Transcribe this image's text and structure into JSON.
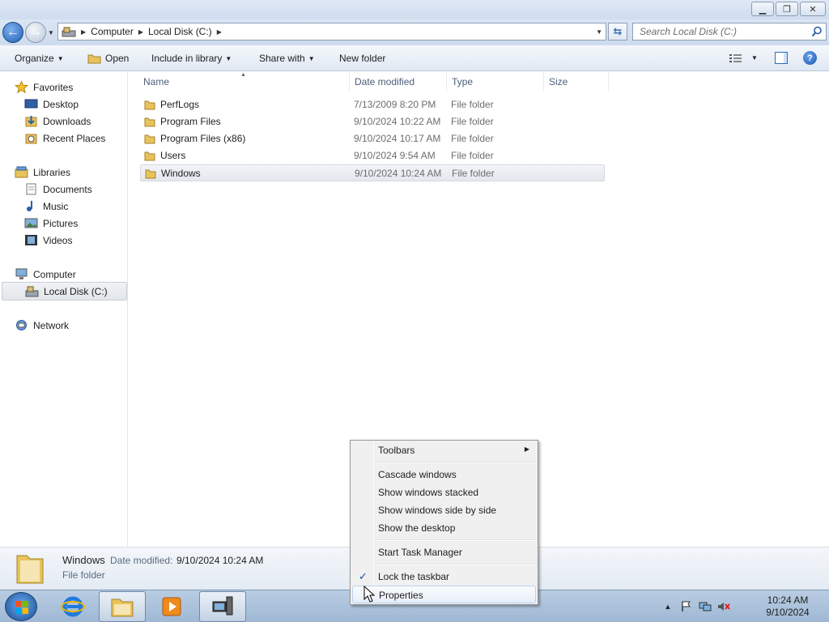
{
  "window": {
    "minimize_icon": "minimize-icon",
    "maximize_icon": "restore-icon",
    "close_icon": "close-icon"
  },
  "address": {
    "crumbs": [
      "Computer",
      "Local Disk (C:)"
    ],
    "search_placeholder": "Search Local Disk (C:)"
  },
  "commands": {
    "organize": "Organize",
    "open": "Open",
    "include_in_library": "Include in library",
    "share_with": "Share with",
    "new_folder": "New folder"
  },
  "nav": {
    "favorites": "Favorites",
    "desktop": "Desktop",
    "downloads": "Downloads",
    "recent_places": "Recent Places",
    "libraries": "Libraries",
    "documents": "Documents",
    "music": "Music",
    "pictures": "Pictures",
    "videos": "Videos",
    "computer": "Computer",
    "local_disk": "Local Disk (C:)",
    "network": "Network"
  },
  "columns": {
    "name": "Name",
    "date_modified": "Date modified",
    "type": "Type",
    "size": "Size"
  },
  "files": [
    {
      "name": "PerfLogs",
      "date": "7/13/2009 8:20 PM",
      "type": "File folder"
    },
    {
      "name": "Program Files",
      "date": "9/10/2024 10:22 AM",
      "type": "File folder"
    },
    {
      "name": "Program Files (x86)",
      "date": "9/10/2024 10:17 AM",
      "type": "File folder"
    },
    {
      "name": "Users",
      "date": "9/10/2024 9:54 AM",
      "type": "File folder"
    },
    {
      "name": "Windows",
      "date": "9/10/2024 10:24 AM",
      "type": "File folder"
    }
  ],
  "details": {
    "name": "Windows",
    "date_label": "Date modified:",
    "date_value": "9/10/2024 10:24 AM",
    "type": "File folder"
  },
  "context_menu": {
    "toolbars": "Toolbars",
    "cascade": "Cascade windows",
    "stacked": "Show windows stacked",
    "side_by_side": "Show windows side by side",
    "show_desktop": "Show the desktop",
    "task_manager": "Start Task Manager",
    "lock_taskbar": "Lock the taskbar",
    "lock_checked": true,
    "properties": "Properties"
  },
  "taskbar": {
    "time": "10:24 AM",
    "date": "9/10/2024",
    "apps": [
      "internet-explorer-icon",
      "windows-explorer-icon",
      "media-player-icon",
      "remote-desktop-icon"
    ]
  }
}
